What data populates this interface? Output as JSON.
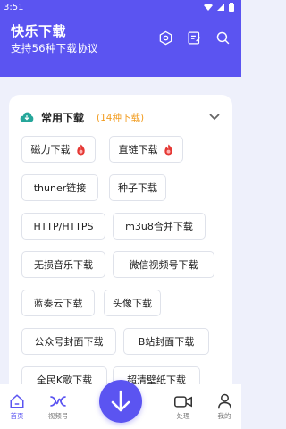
{
  "status_bar": {
    "time": "3:51"
  },
  "header": {
    "title": "快乐下载",
    "subtitle": "支持56种下载协议"
  },
  "colors": {
    "accent": "#5b54f1",
    "count": "#f29c1f",
    "hot_badge": "#e53935",
    "section_icon": "#26a69a"
  },
  "section": {
    "title": "常用下载",
    "count": "(14种下载)"
  },
  "tags": [
    {
      "label": "磁力下载",
      "hot": true
    },
    {
      "label": "直链下载",
      "hot": true
    },
    {
      "label": "thuner链接",
      "hot": false
    },
    {
      "label": "种子下载",
      "hot": false
    },
    {
      "label": "HTTP/HTTPS",
      "hot": false
    },
    {
      "label": "m3u8合并下载",
      "hot": false
    },
    {
      "label": "无损音乐下载",
      "hot": false
    },
    {
      "label": "微信视频号下载",
      "hot": false
    },
    {
      "label": "蓝奏云下载",
      "hot": false
    },
    {
      "label": "头像下载",
      "hot": false
    },
    {
      "label": "公众号封面下载",
      "hot": false
    },
    {
      "label": "B站封面下载",
      "hot": false
    },
    {
      "label": "全民K歌下载",
      "hot": false
    },
    {
      "label": "超清壁纸下载",
      "hot": false
    }
  ],
  "nav": {
    "home": "首页",
    "video": "视频号",
    "process": "处理",
    "mine": "我的"
  }
}
